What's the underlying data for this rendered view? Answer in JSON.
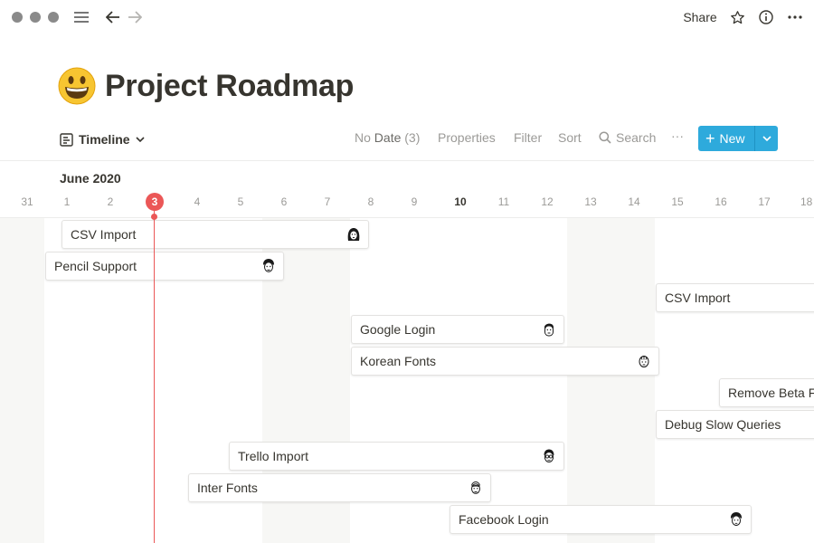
{
  "topbar": {
    "share_label": "Share"
  },
  "page": {
    "title": "Project Roadmap",
    "emoji": "grinning-face"
  },
  "toolbar": {
    "view_label": "Timeline",
    "no_date_label": "No",
    "no_date_strong": "Date",
    "no_date_count": "(3)",
    "properties_label": "Properties",
    "filter_label": "Filter",
    "sort_label": "Sort",
    "search_label": "Search",
    "more_label": "···",
    "new_label": "New"
  },
  "timeline": {
    "month": "June 2020",
    "today": "3",
    "days": [
      "31",
      "1",
      "2",
      "3",
      "4",
      "5",
      "6",
      "7",
      "8",
      "9",
      "10",
      "11",
      "12",
      "13",
      "14",
      "15",
      "16",
      "17",
      "18"
    ],
    "tasks": [
      {
        "name": "CSV Import",
        "avatar": "avatar-woman"
      },
      {
        "name": "Pencil Support",
        "avatar": "avatar-man"
      },
      {
        "name": "CSV Import",
        "avatar": ""
      },
      {
        "name": "Google Login",
        "avatar": "avatar-man"
      },
      {
        "name": "Korean Fonts",
        "avatar": "avatar-man"
      },
      {
        "name": "Remove Beta F",
        "avatar": ""
      },
      {
        "name": "Debug Slow Queries",
        "avatar": ""
      },
      {
        "name": "Trello Import",
        "avatar": "avatar-man-glasses"
      },
      {
        "name": "Inter Fonts",
        "avatar": "avatar-man"
      },
      {
        "name": "Facebook Login",
        "avatar": "avatar-man"
      }
    ]
  },
  "colors": {
    "accent": "#2eaadc",
    "today": "#eb5757",
    "weekend_shade": "#f7f7f5",
    "text": "#37352f",
    "muted": "#9b9a97"
  }
}
